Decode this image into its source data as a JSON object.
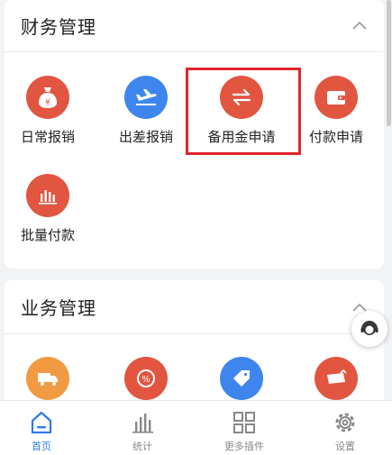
{
  "finance": {
    "title": "财务管理",
    "items": [
      {
        "label": "日常报销",
        "icon": "money-bag-icon",
        "color": "#e25540"
      },
      {
        "label": "出差报销",
        "icon": "airplane-icon",
        "color": "#3e86ee"
      },
      {
        "label": "备用金申请",
        "icon": "exchange-arrows-icon",
        "color": "#e25540"
      },
      {
        "label": "付款申请",
        "icon": "wallet-icon",
        "color": "#e25540"
      },
      {
        "label": "批量付款",
        "icon": "bar-chart-icon",
        "color": "#e25540"
      }
    ]
  },
  "business": {
    "title": "业务管理",
    "items": [
      {
        "icon": "truck-icon",
        "color": "#f29a41"
      },
      {
        "icon": "percent-badge-icon",
        "color": "#e25540"
      },
      {
        "icon": "price-tag-icon",
        "color": "#3e86ee"
      },
      {
        "icon": "ticket-icon",
        "color": "#e25540"
      }
    ]
  },
  "tabbar": {
    "tabs": [
      {
        "label": "首页",
        "icon": "home-icon",
        "active": true
      },
      {
        "label": "统计",
        "icon": "statistics-icon",
        "active": false
      },
      {
        "label": "更多插件",
        "icon": "grid-plugins-icon",
        "active": false
      },
      {
        "label": "设置",
        "icon": "settings-gear-icon",
        "active": false
      }
    ]
  },
  "colors": {
    "accent": "#2d7be5",
    "highlight": "#e0252b"
  }
}
